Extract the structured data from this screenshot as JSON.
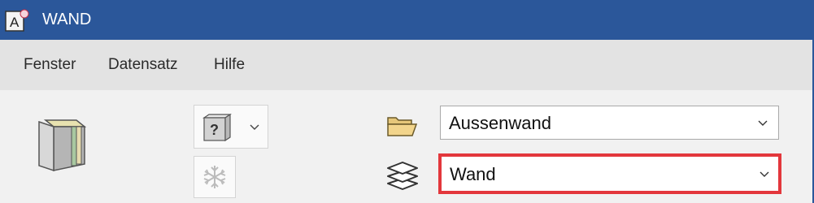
{
  "window": {
    "title": "WAND"
  },
  "menu": {
    "items": [
      "Fenster",
      "Datensatz",
      "Hilfe"
    ]
  },
  "toolbar": {
    "type_dropdown_icon": "question-block-icon",
    "snow_icon": "snowflake-icon"
  },
  "fields": {
    "catalog": {
      "icon": "folder-open-icon",
      "value": "Aussenwand"
    },
    "layer": {
      "icon": "layers-icon",
      "value": "Wand",
      "highlight_color": "#e3373c"
    }
  },
  "colors": {
    "titlebar": "#2b579a",
    "accent_highlight": "#e3373c"
  }
}
